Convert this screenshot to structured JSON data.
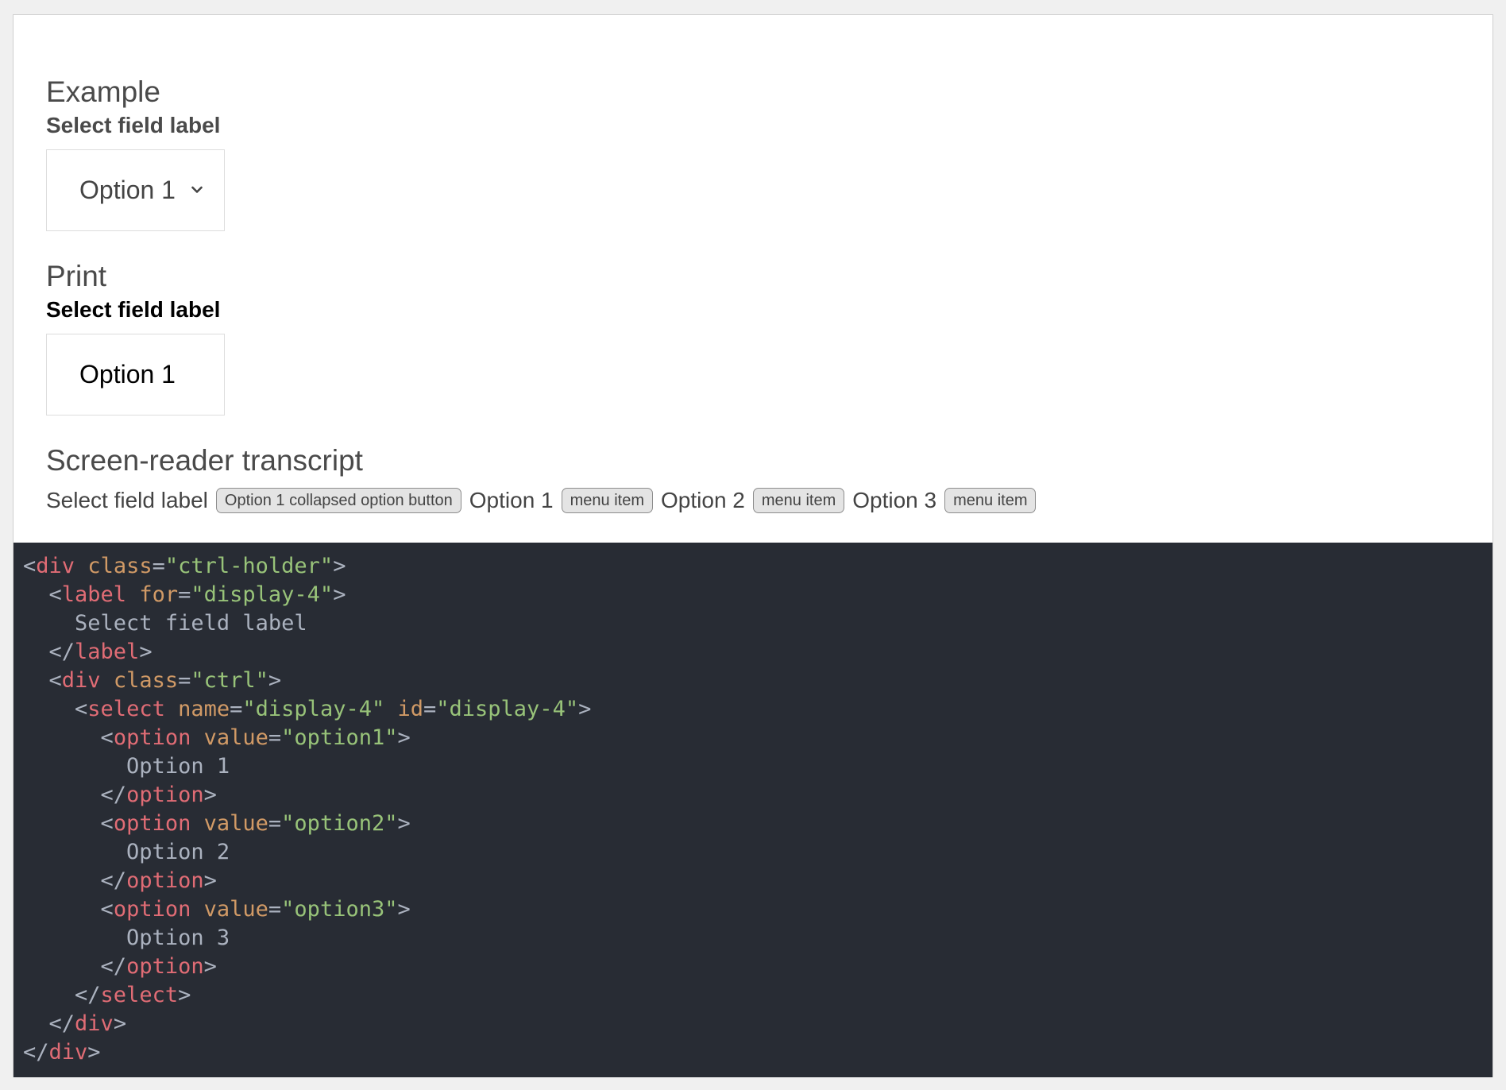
{
  "example": {
    "heading": "Example",
    "field_label": "Select field label",
    "selected_value": "Option 1",
    "icon": "chevron-down-icon"
  },
  "print": {
    "heading": "Print",
    "field_label": "Select field label",
    "selected_value": "Option 1"
  },
  "transcript": {
    "heading": "Screen-reader transcript",
    "label_text": "Select field label",
    "button_badge": "Option 1 collapsed option button",
    "items": [
      {
        "text": "Option 1",
        "badge": "menu item"
      },
      {
        "text": "Option 2",
        "badge": "menu item"
      },
      {
        "text": "Option 3",
        "badge": "menu item"
      }
    ]
  },
  "code": {
    "colors": {
      "background": "#282c34",
      "tag": "#e06c75",
      "attr": "#d19a66",
      "string": "#98c379",
      "text": "#abb2bf"
    },
    "lines": [
      {
        "indent": 0,
        "type": "open",
        "tag": "div",
        "attrs": [
          {
            "name": "class",
            "value": "ctrl-holder"
          }
        ]
      },
      {
        "indent": 1,
        "type": "open",
        "tag": "label",
        "attrs": [
          {
            "name": "for",
            "value": "display-4"
          }
        ]
      },
      {
        "indent": 2,
        "type": "text",
        "text": "Select field label"
      },
      {
        "indent": 1,
        "type": "close",
        "tag": "label"
      },
      {
        "indent": 1,
        "type": "open",
        "tag": "div",
        "attrs": [
          {
            "name": "class",
            "value": "ctrl"
          }
        ]
      },
      {
        "indent": 2,
        "type": "open",
        "tag": "select",
        "attrs": [
          {
            "name": "name",
            "value": "display-4"
          },
          {
            "name": "id",
            "value": "display-4"
          }
        ]
      },
      {
        "indent": 3,
        "type": "open",
        "tag": "option",
        "attrs": [
          {
            "name": "value",
            "value": "option1"
          }
        ]
      },
      {
        "indent": 4,
        "type": "text",
        "text": "Option 1"
      },
      {
        "indent": 3,
        "type": "close",
        "tag": "option"
      },
      {
        "indent": 3,
        "type": "open",
        "tag": "option",
        "attrs": [
          {
            "name": "value",
            "value": "option2"
          }
        ]
      },
      {
        "indent": 4,
        "type": "text",
        "text": "Option 2"
      },
      {
        "indent": 3,
        "type": "close",
        "tag": "option"
      },
      {
        "indent": 3,
        "type": "open",
        "tag": "option",
        "attrs": [
          {
            "name": "value",
            "value": "option3"
          }
        ]
      },
      {
        "indent": 4,
        "type": "text",
        "text": "Option 3"
      },
      {
        "indent": 3,
        "type": "close",
        "tag": "option"
      },
      {
        "indent": 2,
        "type": "close",
        "tag": "select"
      },
      {
        "indent": 1,
        "type": "close",
        "tag": "div"
      },
      {
        "indent": 0,
        "type": "close",
        "tag": "div"
      }
    ]
  }
}
